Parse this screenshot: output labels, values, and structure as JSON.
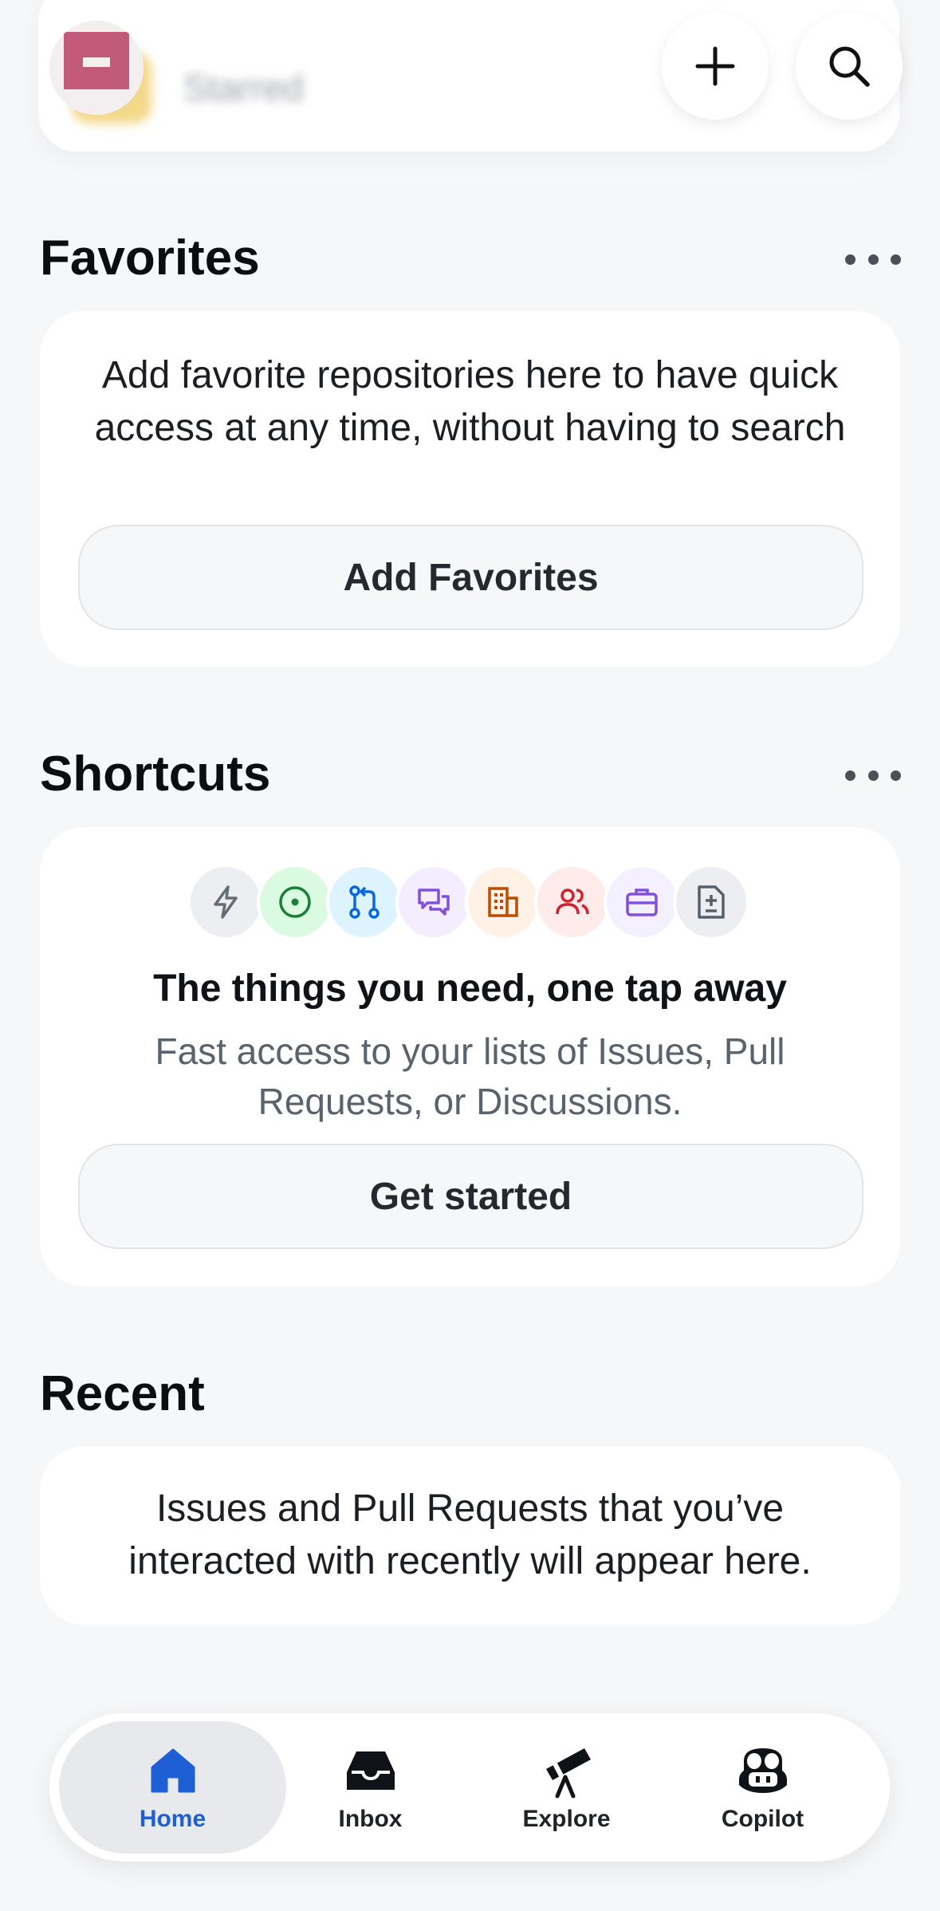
{
  "header": {
    "starred_label": "Starred",
    "actions": [
      {
        "name": "new",
        "icon": "plus-icon"
      },
      {
        "name": "search",
        "icon": "search-icon"
      }
    ]
  },
  "favorites": {
    "title": "Favorites",
    "description": "Add favorite repositories here to have quick access at any time, without having to search",
    "button_label": "Add Favorites"
  },
  "shortcuts": {
    "title": "Shortcuts",
    "icons": [
      {
        "name": "lightning-icon",
        "color": "#656d76",
        "bg": "#eceef1"
      },
      {
        "name": "issue-icon",
        "color": "#1a7f37",
        "bg": "#dafbe1"
      },
      {
        "name": "pull-request-icon",
        "color": "#0969da",
        "bg": "#ddf4ff"
      },
      {
        "name": "discussion-icon",
        "color": "#8250df",
        "bg": "#f3edff"
      },
      {
        "name": "organization-icon",
        "color": "#bc4c00",
        "bg": "#fff1e5"
      },
      {
        "name": "people-icon",
        "color": "#cf222e",
        "bg": "#ffebe9"
      },
      {
        "name": "briefcase-icon",
        "color": "#8250df",
        "bg": "#f5f0ff"
      },
      {
        "name": "diff-icon",
        "color": "#57606a",
        "bg": "#eceef1"
      }
    ],
    "headline": "The things you need, one tap away",
    "description": "Fast access to your lists of Issues, Pull Requests, or Discussions.",
    "button_label": "Get started"
  },
  "recent": {
    "title": "Recent",
    "description": "Issues and Pull Requests that you’ve interacted with recently will appear here."
  },
  "tabbar": {
    "active": "home",
    "tabs": [
      {
        "label": "Home",
        "icon": "home-icon"
      },
      {
        "label": "Inbox",
        "icon": "inbox-icon"
      },
      {
        "label": "Explore",
        "icon": "telescope-icon"
      },
      {
        "label": "Copilot",
        "icon": "copilot-icon"
      }
    ],
    "accent_color": "#1f5fd6"
  }
}
